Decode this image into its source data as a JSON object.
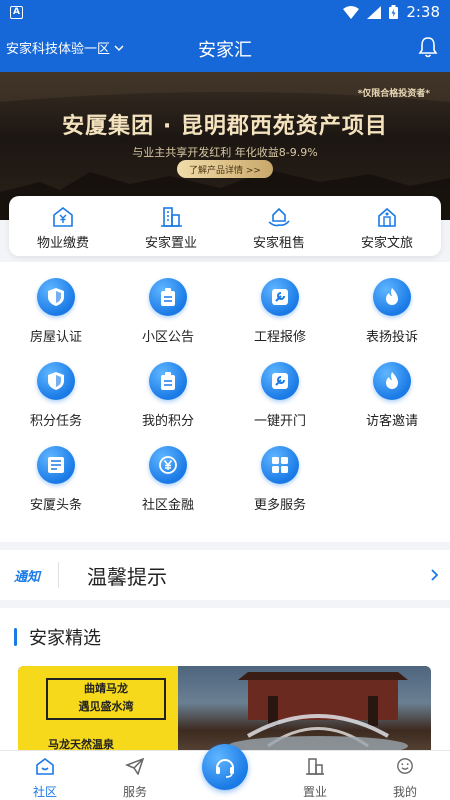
{
  "status_bar": {
    "notification_badge": "A",
    "time": "2:38",
    "icons": [
      "wifi-icon",
      "signal-icon",
      "battery-icon"
    ]
  },
  "header": {
    "community": "安家科技体验一区",
    "title": "安家汇",
    "bell_icon": "bell-icon"
  },
  "banner": {
    "qualifier": "*仅限合格投资者*",
    "headline": "安厦集团 · 昆明郡西苑资产项目",
    "subtitle": "与业主共享开发红利  年化收益8-9.9%",
    "button": "了解产品详情 >>"
  },
  "quick_bar": [
    {
      "label": "物业缴费",
      "icon": "payment-icon"
    },
    {
      "label": "安家置业",
      "icon": "building-icon"
    },
    {
      "label": "安家租售",
      "icon": "house-hand-icon"
    },
    {
      "label": "安家文旅",
      "icon": "travel-icon"
    }
  ],
  "services": [
    {
      "label": "房屋认证",
      "icon": "shield-icon"
    },
    {
      "label": "小区公告",
      "icon": "notice-icon"
    },
    {
      "label": "工程报修",
      "icon": "wrench-icon"
    },
    {
      "label": "表扬投诉",
      "icon": "flame-icon"
    },
    {
      "label": "积分任务",
      "icon": "shield-icon"
    },
    {
      "label": "我的积分",
      "icon": "notice-icon"
    },
    {
      "label": "一键开门",
      "icon": "wrench-icon"
    },
    {
      "label": "访客邀请",
      "icon": "flame-icon"
    },
    {
      "label": "安厦头条",
      "icon": "news-icon"
    },
    {
      "label": "社区金融",
      "icon": "yen-icon"
    },
    {
      "label": "更多服务",
      "icon": "grid-icon"
    }
  ],
  "notice": {
    "tag": "通知",
    "title": "温馨提示"
  },
  "featured": {
    "title": "安家精选",
    "card": {
      "line1": "曲靖马龙",
      "line2": "遇见盛水湾",
      "line3": "马龙天然温泉"
    }
  },
  "tabbar": [
    {
      "label": "社区",
      "icon": "home-icon",
      "active": true
    },
    {
      "label": "服务",
      "icon": "send-icon",
      "active": false
    },
    {
      "label": "置业",
      "icon": "building-icon",
      "active": false
    },
    {
      "label": "我的",
      "icon": "smile-icon",
      "active": false
    }
  ],
  "colors": {
    "primary": "#1667d8",
    "accent": "#1a7ae6"
  }
}
